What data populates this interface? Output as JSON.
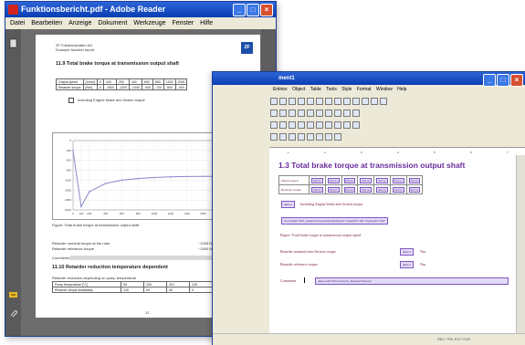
{
  "reader": {
    "title": "Funktionsbericht.pdf - Adobe Reader",
    "menu": [
      "Datei",
      "Bearbeiten",
      "Anzeige",
      "Dokument",
      "Werkzeuge",
      "Fenster",
      "Hilfe"
    ],
    "page": {
      "header_line1": "ZF Friedrichshafen AG",
      "header_line2": "Example function report",
      "logo": "ZF",
      "section_heading": "11.9 Total brake torque at transmission output shaft",
      "table": {
        "rows": [
          {
            "label": "Output speed",
            "unit": "[1/min]",
            "values": [
              "0",
              "100",
              "200",
              "400",
              "600",
              "800",
              "1000",
              "2000"
            ]
          },
          {
            "label": "Retarder torque",
            "unit": "[Nm]",
            "values": [
              "0",
              "-1600",
              "-1200",
              "-1000",
              "-900",
              "-700",
              "-500",
              "-400"
            ]
          }
        ]
      },
      "checkbox_label": "Including Engine brake and friction torque",
      "figure_caption": "Figure: Total brake torque at transmission output shaft",
      "value_line1": "Retarder nominal torque at the rotor",
      "value_line1_val": "~1000 Nm",
      "value_line2": "Retarder reference torque",
      "value_line2_val": "~1500 Nm",
      "comment_label": "Comments",
      "section2_heading": "11.10 Retarder reduction temperature dependent",
      "section2_sub": "Retarder reduction depending on pump temperature",
      "table2": {
        "rows": [
          {
            "label": "Pump temperature [°C]",
            "values": [
              "90",
              "100",
              "110",
              "120"
            ]
          },
          {
            "label": "Retarder torque availability",
            "values": [
              "100",
              "90",
              "50",
              "0"
            ]
          }
        ]
      },
      "page_number": "12"
    }
  },
  "word": {
    "title": "ment1",
    "menu": [
      "Entries",
      "Object",
      "Table",
      "Tools",
      "Style",
      "Format",
      "Window",
      "Help"
    ],
    "status": "REC  TRK  EXT  OVR",
    "doc": {
      "heading": "1.3 Total brake torque at transmission output shaft",
      "row1_label": "Output speed",
      "row2_label": "Retarder torque",
      "cell_tag": "data no",
      "cell_count": 7,
      "including_tag": "data m",
      "including_text": "Including Engine brake and friction torque",
      "chart_tag": "chart datat=\"DF1_RetarderTorqueAtOutputSpeed\" imgwidth=\"100\" imgheight=\"100\"",
      "figure_text": "Figure: Total brake torque at transmission output speed",
      "nominal_text": "Retarder nominal retar flection torque",
      "nominal_tag": "data m",
      "nominal_unit": "Nm",
      "reference_text": "Retarder reference torque",
      "reference_tag": "data m",
      "reference_unit": "Nm",
      "comments_label": "Comments",
      "comments_tag": "data mark=\"DS:Comment_RetarderTorque1\""
    }
  },
  "chart_data": {
    "type": "line",
    "title": "",
    "xlabel": "rpm",
    "ylabel": "",
    "x": [
      0,
      100,
      200,
      400,
      600,
      800,
      1000,
      1200,
      1400,
      1600,
      1800,
      2000
    ],
    "series": [
      {
        "name": "",
        "values": [
          -300,
          -2000,
          -1550,
          -1300,
          -1200,
          -1150,
          -1120,
          -1100,
          -1090,
          -1085,
          -1080,
          -1080
        ]
      }
    ],
    "xlim": [
      0,
      2000
    ],
    "ylim": [
      -2100,
      0
    ],
    "grid": true,
    "color": "#8888cc"
  }
}
